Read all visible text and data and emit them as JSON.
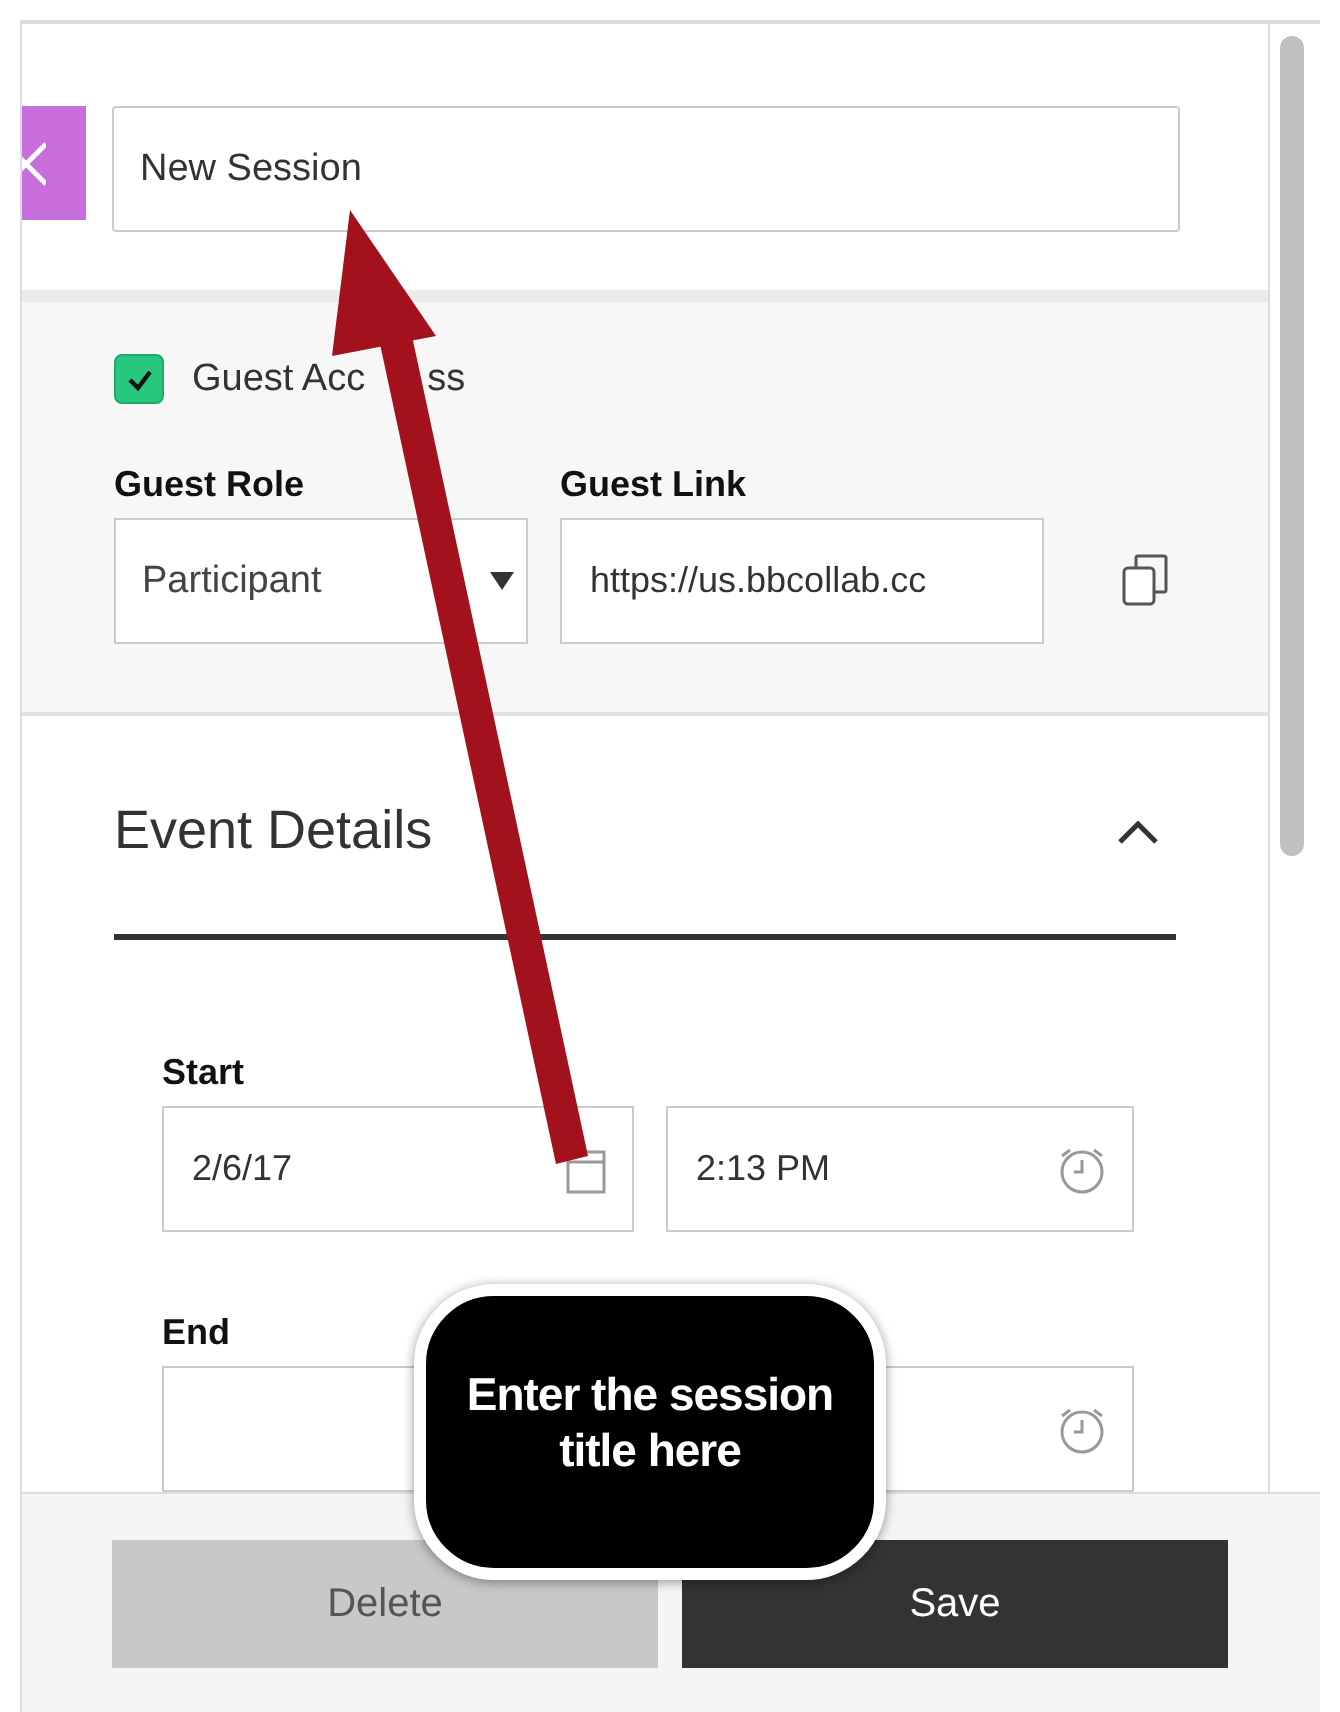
{
  "title_field": {
    "value": "New Session"
  },
  "guest_access": {
    "label": "Guest Acc",
    "label_end": "ss",
    "checked": true
  },
  "guest_role": {
    "label": "Guest Role",
    "value": "Participant"
  },
  "guest_link": {
    "label": "Guest Link",
    "value": "https://us.bbcollab.cc"
  },
  "event_details": {
    "title": "Event Details",
    "expanded": true
  },
  "start": {
    "label": "Start",
    "date": "2/6/17",
    "time": "2:13 PM"
  },
  "end": {
    "label": "End"
  },
  "buttons": [
    {
      "label": "Delete",
      "kind": "secondary"
    },
    {
      "label": "Save",
      "kind": "primary"
    }
  ],
  "callout": {
    "text": "Enter the session title here"
  }
}
